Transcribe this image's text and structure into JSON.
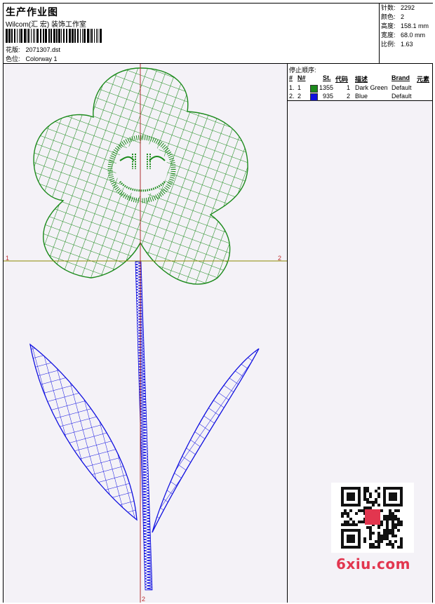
{
  "header": {
    "title": "生产作业图",
    "studio": "Wilcom(汇 宏) 装饰工作室",
    "design_label": "花版:",
    "design_value": "2071307.dst",
    "colorway_label": "色位:",
    "colorway_value": "Colorway 1"
  },
  "stats": [
    {
      "label": "针数:",
      "value": "2292"
    },
    {
      "label": "颜色:",
      "value": "2"
    },
    {
      "label": "高度:",
      "value": "158.1 mm"
    },
    {
      "label": "宽度:",
      "value": "68.0 mm"
    },
    {
      "label": "比例:",
      "value": "1.63"
    }
  ],
  "stop_sequence": {
    "title": "停止顺序:",
    "columns": [
      "#",
      "N#",
      "St.",
      "代码",
      "描述",
      "Brand",
      "元素"
    ],
    "rows": [
      {
        "num": "1.",
        "n": "1",
        "color": "#1b8a1b",
        "stitches": "1355",
        "code": "1",
        "description": "Dark Green",
        "brand": "Default"
      },
      {
        "num": "2.",
        "n": "2",
        "color": "#1010e0",
        "stitches": "935",
        "code": "2",
        "description": "Blue",
        "brand": "Default"
      }
    ]
  },
  "canvas": {
    "axis_h_left": "1",
    "axis_h_right": "2",
    "axis_v_bottom": "2",
    "flower_color": "#1b8a1b",
    "stem_color": "#1010e0",
    "axis_h_color": "#8c8a00",
    "axis_v_color": "#b03030"
  },
  "watermark": {
    "logo_text": "6xiu.com"
  }
}
